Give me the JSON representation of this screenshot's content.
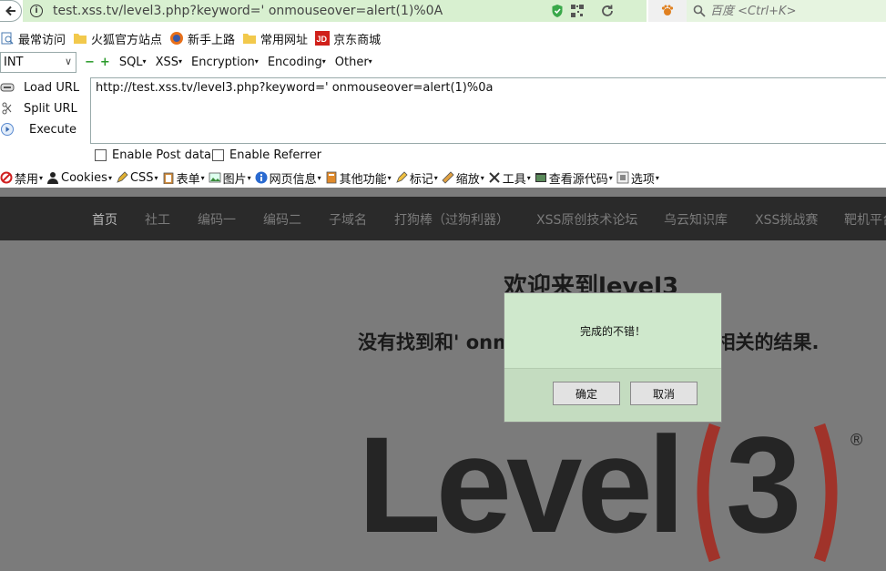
{
  "browser": {
    "url": "test.xss.tv/level3.php?keyword=' onmouseover=alert(1)%0A",
    "search_placeholder": "百度 <Ctrl+K>"
  },
  "bookmarks": [
    "最常访问",
    "火狐官方站点",
    "新手上路",
    "常用网址",
    "京东商城"
  ],
  "hackbar": {
    "select_value": "INT",
    "menus": [
      "SQL",
      "XSS",
      "Encryption",
      "Encoding",
      "Other"
    ],
    "side_buttons": [
      "Load URL",
      "Split URL",
      "Execute"
    ],
    "url_value": "http://test.xss.tv/level3.php?keyword=' onmouseover=alert(1)%0a",
    "options": [
      "Enable Post data",
      "Enable Referrer"
    ]
  },
  "webdev_toolbar": [
    "禁用",
    "Cookies",
    "CSS",
    "表单",
    "图片",
    "网页信息",
    "其他功能",
    "标记",
    "缩放",
    "工具",
    "查看源代码",
    "选项"
  ],
  "page": {
    "nav": [
      "首页",
      "社工",
      "编码一",
      "编码二",
      "子域名",
      "打狗棒（过狗利器）",
      "XSS原创技术论坛",
      "乌云知识库",
      "XSS挑战赛",
      "靶机平台"
    ],
    "welcome": "欢迎来到level3",
    "result": "没有找到和' onmouseover=alert(1) 相关的结果.",
    "logo_text": "Level",
    "logo_number": "3",
    "logo_registered": "®"
  },
  "dialog": {
    "message": "完成的不错！",
    "ok_label": "确定",
    "cancel_label": "取消"
  },
  "colors": {
    "url_bar": "#d8f0d0",
    "page_bg": "#7b7b7b",
    "nav_bg": "#2a2a2a",
    "logo_red": "#a0332a",
    "dialog_bg": "#cfe8cc"
  }
}
